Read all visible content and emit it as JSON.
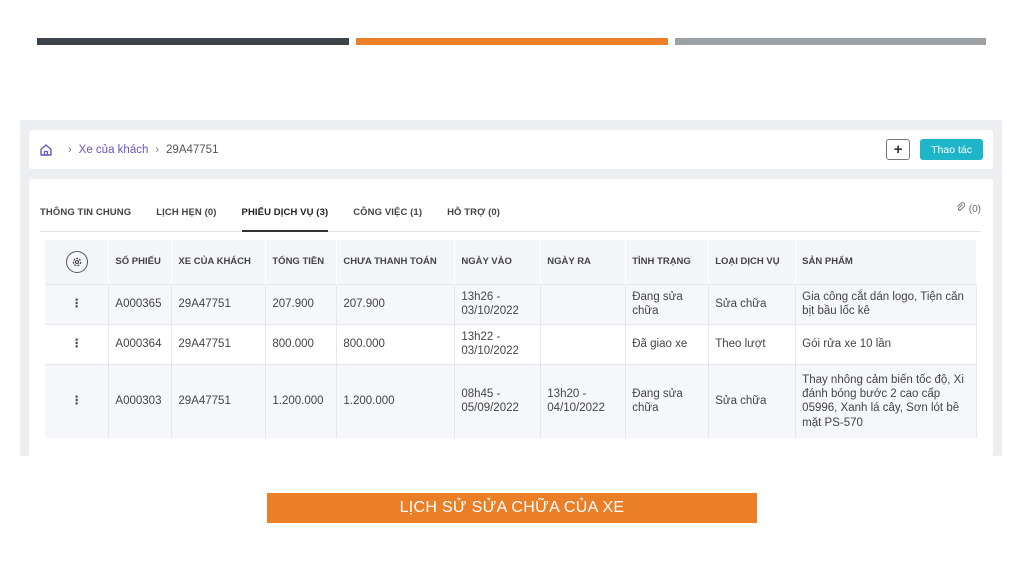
{
  "decor": {
    "colors": [
      "#3c434b",
      "#ea7f27",
      "#9ca1a6"
    ]
  },
  "breadcrumb": {
    "home_icon": "home-icon",
    "items": [
      "Xe của khách",
      "29A47751"
    ]
  },
  "header": {
    "plus_label": "+",
    "action_label": "Thao tác"
  },
  "tabs": [
    {
      "label": "THÔNG TIN CHUNG",
      "active": false
    },
    {
      "label": "LỊCH HẸN (0)",
      "active": false
    },
    {
      "label": "PHIẾU DỊCH VỤ (3)",
      "active": true
    },
    {
      "label": "CÔNG VIỆC (1)",
      "active": false
    },
    {
      "label": "HỖ TRỢ (0)",
      "active": false
    }
  ],
  "attachments": {
    "icon": "paperclip-icon",
    "count_label": "(0)"
  },
  "table": {
    "settings_icon": "gear-icon",
    "columns": [
      "SỐ PHIẾU",
      "XE CỦA KHÁCH",
      "TỔNG TIỀN",
      "CHƯA THANH TOÁN",
      "NGÀY VÀO",
      "NGÀY RA",
      "TÌNH TRẠNG",
      "LOẠI DỊCH VỤ",
      "SẢN PHẨM"
    ],
    "rows": [
      {
        "menu": "⋮",
        "code": "A000365",
        "plate": "29A47751",
        "total": "207.900",
        "unpaid": "207.900",
        "date_in": "13h26 - 03/10/2022",
        "date_out": "",
        "status": "Đang sửa chữa",
        "service_type": "Sửa chữa",
        "products": "Gia công cắt dán logo, Tiện căn bịt bầu lốc kê"
      },
      {
        "menu": "⋮",
        "code": "A000364",
        "plate": "29A47751",
        "total": "800.000",
        "unpaid": "800.000",
        "date_in": "13h22 - 03/10/2022",
        "date_out": "",
        "status": "Đã giao xe",
        "service_type": "Theo lượt",
        "products": "Gói rửa xe 10 lần"
      },
      {
        "menu": "⋮",
        "code": "A000303",
        "plate": "29A47751",
        "total": "1.200.000",
        "unpaid": "1.200.000",
        "date_in": "08h45 - 05/09/2022",
        "date_out": "13h20 - 04/10/2022",
        "status": "Đang sửa chữa",
        "service_type": "Sửa chữa",
        "products": "Thay nhông cảm biến tốc độ, Xi đánh bóng bước 2 cao cấp 05996, Xanh lá cây, Sơn lót bề mặt PS-570"
      }
    ]
  },
  "caption": "LỊCH SỬ SỬA CHỮA CỦA XE"
}
